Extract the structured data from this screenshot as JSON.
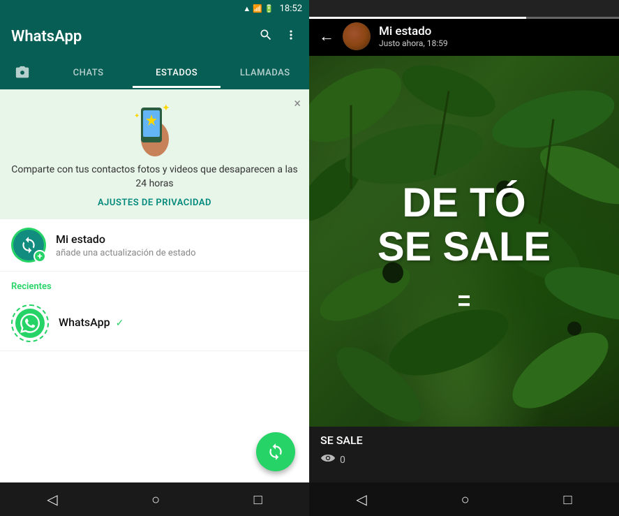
{
  "left": {
    "statusBar": {
      "time": "18:52",
      "icons": [
        "signal",
        "wifi",
        "battery"
      ]
    },
    "header": {
      "title": "WhatsApp",
      "searchLabel": "search",
      "moreLabel": "more"
    },
    "tabs": [
      {
        "id": "camera",
        "label": "📷",
        "isCamera": true
      },
      {
        "id": "chats",
        "label": "CHATS"
      },
      {
        "id": "estados",
        "label": "ESTADOS",
        "active": true
      },
      {
        "id": "llamadas",
        "label": "LLAMADAS"
      }
    ],
    "promoBanner": {
      "text": "Comparte con tus contactos fotos y videos que desaparecen a las 24 horas",
      "linkText": "AJUSTES DE PRIVACIDAD",
      "closeLabel": "×"
    },
    "myStatus": {
      "title": "Mi estado",
      "subtitle": "añade una actualización de estado"
    },
    "recientes": {
      "label": "Recientes"
    },
    "whatsappStatus": {
      "name": "WhatsApp",
      "verified": "✓"
    },
    "fab": {
      "label": "+"
    },
    "navBar": {
      "back": "◁",
      "home": "○",
      "recent": "□"
    }
  },
  "right": {
    "header": {
      "backLabel": "←",
      "title": "Mi estado",
      "subtitle": "Justo ahora, 18:59"
    },
    "statusImage": {
      "mainText1": "DE TÓ",
      "mainText2": "SE SALE"
    },
    "statusBottom": {
      "caption": "SE SALE",
      "viewsIcon": "👁",
      "viewsCount": "0"
    },
    "navBar": {
      "back": "◁",
      "home": "○",
      "recent": "□"
    }
  }
}
